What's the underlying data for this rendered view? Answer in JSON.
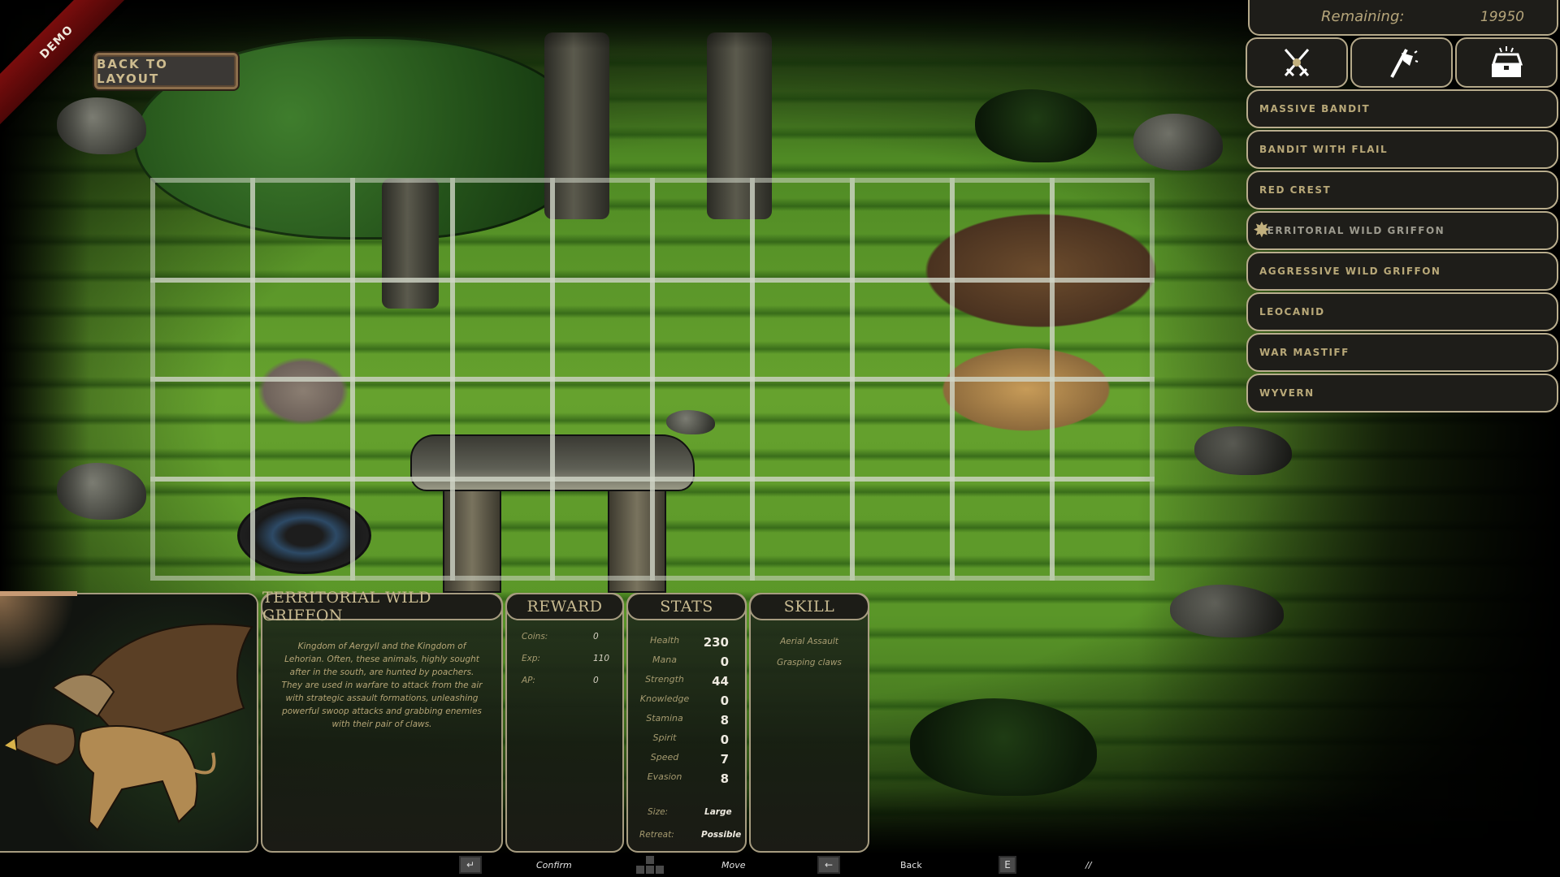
{
  "ribbon": {
    "label": "DEMO"
  },
  "back_button": {
    "label": "BACK TO LAYOUT"
  },
  "remaining": {
    "label": "Remaining:",
    "value": "19950"
  },
  "category_tabs": [
    {
      "icon": "crossed-swords-icon",
      "label": "Battle"
    },
    {
      "icon": "axe-icon",
      "label": "Equipment"
    },
    {
      "icon": "treasure-chest-icon",
      "label": "Loot"
    }
  ],
  "enemy_list": [
    {
      "label": "MASSIVE BANDIT",
      "selected": false
    },
    {
      "label": "BANDIT WITH FLAIL",
      "selected": false
    },
    {
      "label": "RED CREST",
      "selected": false
    },
    {
      "label": "TERRITORIAL WILD GRIFFON",
      "selected": true
    },
    {
      "label": "AGGRESSIVE WILD GRIFFON",
      "selected": false
    },
    {
      "label": "LEOCANID",
      "selected": false
    },
    {
      "label": "WAR MASTIFF",
      "selected": false
    },
    {
      "label": "WYVERN",
      "selected": false
    }
  ],
  "grid": {
    "columns": 10,
    "rows": 4
  },
  "info": {
    "name": "TERRITORIAL WILD GRIFFON",
    "description": "Kingdom of Aergyll and the Kingdom of Lehorian. Often, these animals, highly sought after in the south, are hunted by poachers. They are used in warfare to attack from the air with strategic assault formations, unleashing powerful swoop attacks and grabbing enemies with their pair of claws.",
    "reward": {
      "title": "REWARD",
      "rows": [
        {
          "label": "Coins:",
          "value": "0"
        },
        {
          "label": "Exp:",
          "value": "110"
        },
        {
          "label": "AP:",
          "value": "0"
        }
      ]
    },
    "stats": {
      "title": "STATS",
      "rows": [
        {
          "label": "Health",
          "value": "230"
        },
        {
          "label": "Mana",
          "value": "0"
        },
        {
          "label": "Strength",
          "value": "44"
        },
        {
          "label": "Knowledge",
          "value": "0"
        },
        {
          "label": "Stamina",
          "value": "8"
        },
        {
          "label": "Spirit",
          "value": "0"
        },
        {
          "label": "Speed",
          "value": "7"
        },
        {
          "label": "Evasion",
          "value": "8"
        }
      ],
      "size_label": "Size:",
      "size_value": "Large",
      "retreat_label": "Retreat:",
      "retreat_value": "Possible"
    },
    "skill": {
      "title": "SKILL",
      "items": [
        "Aerial Assault",
        "Grasping claws"
      ]
    }
  },
  "footer_hints": [
    {
      "key": "↵",
      "label": "Confirm"
    },
    {
      "key": "arrows",
      "label": "Move"
    },
    {
      "key": "←",
      "label": "Back"
    },
    {
      "key": "E",
      "label": "//"
    }
  ]
}
